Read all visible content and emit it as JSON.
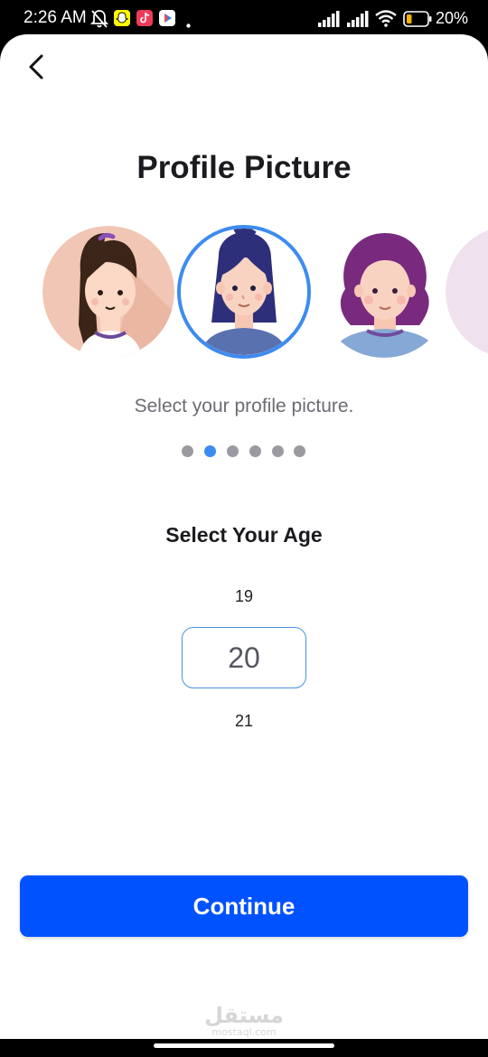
{
  "status_bar": {
    "time": "2:26 AM",
    "battery_percent": "20%",
    "left_icons": [
      "bell-off-icon",
      "snapchat-icon",
      "tiktok-icon",
      "play-games-icon",
      "dot-icon"
    ],
    "right_icons": [
      "signal-icon",
      "signal-icon",
      "wifi-icon",
      "battery-icon"
    ]
  },
  "header": {
    "back_icon": "chevron-left-icon",
    "title": "Profile Picture"
  },
  "avatars": {
    "items": [
      "avatar-girl-ponytail",
      "avatar-woman-dark-hair",
      "avatar-woman-curly-purple",
      "avatar-partial"
    ],
    "selected_index": 1
  },
  "subtitle": "Select your profile picture.",
  "pagination": {
    "count": 6,
    "active_index": 1
  },
  "age": {
    "heading": "Select Your Age",
    "previous": "19",
    "selected": "20",
    "next": "21"
  },
  "continue_label": "Continue",
  "watermark": {
    "arabic": "مستقل",
    "latin": "mostaql.com"
  },
  "colors": {
    "accent": "#3d8bf0",
    "button": "#0052ff",
    "title": "#1b1b1f",
    "muted_text": "#6b6b73"
  }
}
